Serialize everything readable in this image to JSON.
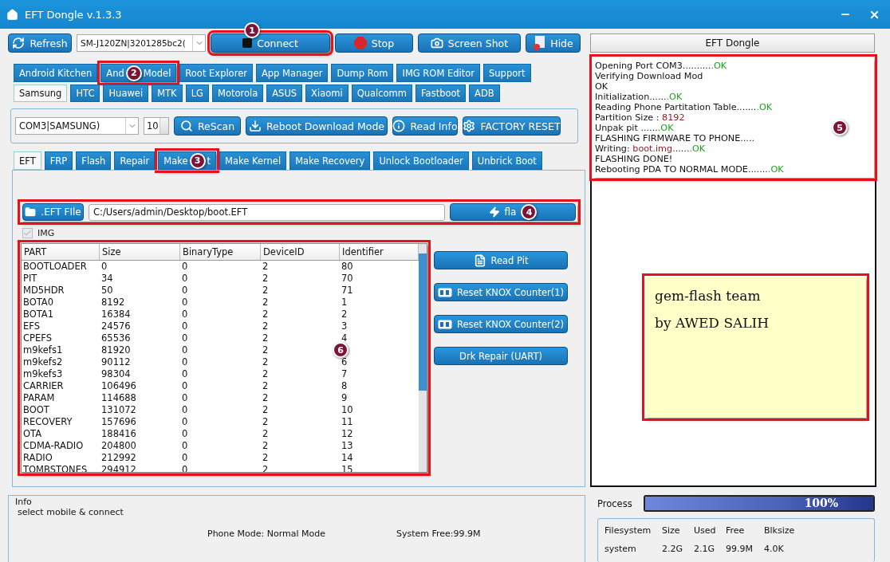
{
  "window": {
    "title": "EFT Dongle  v.1.3.3"
  },
  "toolbar": {
    "buttons": [
      {
        "kind": "refresh",
        "label": "Refresh"
      },
      {
        "kind": "device",
        "value": "SM-J120ZN|3201285bc2("
      },
      {
        "kind": "connect",
        "label": "Connect",
        "marker": "1",
        "highlight": true
      },
      {
        "kind": "stop",
        "label": "Stop"
      },
      {
        "kind": "camera",
        "label": "Screen Shot"
      },
      {
        "kind": "hide",
        "label": "Hide"
      }
    ]
  },
  "main_tabs": [
    {
      "label": "Android Kitchen",
      "selected": false
    },
    {
      "label": "And",
      "marker": "2",
      "label_after": "Model",
      "selected": false,
      "highlight": true
    },
    {
      "label": "Root Explorer",
      "selected": false
    },
    {
      "label": "App Manager",
      "selected": false
    },
    {
      "label": "Dump Rom",
      "selected": false
    },
    {
      "label": "IMG ROM Editor",
      "selected": false
    },
    {
      "label": "Support",
      "selected": false
    }
  ],
  "brand_tabs": [
    {
      "label": "Samsung",
      "selected": true
    },
    {
      "label": "HTC",
      "selected": false
    },
    {
      "label": "Huawei",
      "selected": false
    },
    {
      "label": "MTK",
      "selected": false
    },
    {
      "label": "LG",
      "selected": false
    },
    {
      "label": "Motorola",
      "selected": false
    },
    {
      "label": "ASUS",
      "selected": false
    },
    {
      "label": "Xiaomi",
      "selected": false
    },
    {
      "label": "Qualcomm",
      "selected": false
    },
    {
      "label": "Fastboot",
      "selected": false
    },
    {
      "label": "ADB",
      "selected": false
    }
  ],
  "port_bar": {
    "port": "COM3|SAMSUNG)",
    "count": "10",
    "buttons": [
      {
        "kind": "search",
        "label": "ReScan"
      },
      {
        "kind": "download",
        "label": "Reboot  Download Mode"
      },
      {
        "kind": "info",
        "label": "Read Info"
      },
      {
        "kind": "gear",
        "label": "FACTORY RESET"
      }
    ]
  },
  "sub_tabs": [
    {
      "label": "EFT",
      "selected": true
    },
    {
      "label": "FRP",
      "selected": false
    },
    {
      "label": "Flash",
      "selected": false
    },
    {
      "label": "Repair",
      "selected": false
    },
    {
      "label": "Make",
      "marker": "3",
      "label_after": "t",
      "selected": false,
      "highlight": true
    },
    {
      "label": "Make Kernel",
      "selected": false
    },
    {
      "label": "Make Recovery",
      "selected": false
    },
    {
      "label": "Unlock Bootloader",
      "selected": false
    },
    {
      "label": "Unbrick Boot",
      "selected": false
    }
  ],
  "file_row": {
    "highlight": true,
    "file_button": ".EFT FIle",
    "path": "C:/Users/admin/Desktop/boot.EFT",
    "flash_button": "fla",
    "marker": "4"
  },
  "img_checkbox": {
    "label": "IMG",
    "checked": true,
    "disabled": true
  },
  "table": {
    "highlight": true,
    "marker": "6",
    "columns": [
      "PART",
      "Size",
      "BinaryType",
      "DeviceID",
      "Identifier"
    ],
    "rows": [
      [
        "BOOTLOADER",
        "0",
        "0",
        "2",
        "80"
      ],
      [
        "PIT",
        "34",
        "0",
        "2",
        "70"
      ],
      [
        "MD5HDR",
        "50",
        "0",
        "2",
        "71"
      ],
      [
        "BOTA0",
        "8192",
        "0",
        "2",
        "1"
      ],
      [
        "BOTA1",
        "16384",
        "0",
        "2",
        "2"
      ],
      [
        "EFS",
        "24576",
        "0",
        "2",
        "3"
      ],
      [
        "CPEFS",
        "65536",
        "0",
        "2",
        "4"
      ],
      [
        "m9kefs1",
        "81920",
        "0",
        "2"
      ],
      [
        "m9kefs2",
        "90112",
        "0",
        "2",
        "6"
      ],
      [
        "m9kefs3",
        "98304",
        "0",
        "2",
        "7"
      ],
      [
        "CARRIER",
        "106496",
        "0",
        "2",
        "8"
      ],
      [
        "PARAM",
        "114688",
        "0",
        "2",
        "9"
      ],
      [
        "BOOT",
        "131072",
        "0",
        "2",
        "10"
      ],
      [
        "RECOVERY",
        "157696",
        "0",
        "2",
        "11"
      ],
      [
        "OTA",
        "188416",
        "0",
        "2",
        "12"
      ],
      [
        "CDMA-RADIO",
        "204800",
        "0",
        "2",
        "13"
      ],
      [
        "RADIO",
        "212992",
        "0",
        "2",
        "14"
      ],
      [
        "TOMBSTONES",
        "294912",
        "0",
        "2",
        "15"
      ]
    ]
  },
  "side_buttons": [
    {
      "kind": "document",
      "label": "Read Pit"
    },
    {
      "kind": "knox",
      "label": "Reset KNOX Counter(1)"
    },
    {
      "kind": "knox",
      "label": "Reset KNOX Counter(2)"
    },
    {
      "kind": "plain",
      "label": "Drk Repair (UART)"
    }
  ],
  "info": {
    "title": "Info",
    "message": "select mobile & connect",
    "phone_mode": "Phone Mode: Normal Mode",
    "system_free": "System Free:99.9M"
  },
  "right_panel": {
    "header": "EFT Dongle",
    "log_highlight": true,
    "marker": "5",
    "log": [
      [
        {
          "kind": "plain",
          "text": "Opening Port COM3.........."
        },
        {
          "kind": "ok",
          "text": ".OK"
        }
      ],
      [
        {
          "kind": "plain",
          "text": "Verifying Download Mod"
        }
      ],
      [
        {
          "kind": "plain",
          "text": "OK"
        }
      ],
      [
        {
          "kind": "plain",
          "text": "Initialization......"
        },
        {
          "kind": "ok",
          "text": ".OK"
        }
      ],
      [
        {
          "kind": "plain",
          "text": "Reading Phone Partitation Table......."
        },
        {
          "kind": "ok",
          "text": ".OK"
        }
      ],
      [
        {
          "kind": "plain",
          "text": "Partition Size : "
        },
        {
          "kind": "value",
          "text": "8192"
        }
      ],
      [
        {
          "kind": "plain",
          "text": "Unpak pit ......"
        },
        {
          "kind": "ok",
          "text": ".OK"
        }
      ],
      [
        {
          "kind": "plain",
          "text": "FLASHING FIRMWARE TO PHONE....."
        }
      ],
      [
        {
          "kind": "plain",
          "text": "Writing: "
        },
        {
          "kind": "value",
          "text": "boot.img"
        },
        {
          "kind": "plain",
          "text": "......"
        },
        {
          "kind": "ok",
          "text": ".OK"
        }
      ],
      [
        {
          "kind": "plain",
          "text": "FLASHING DONE!"
        }
      ],
      [
        {
          "kind": "plain",
          "text": "Rebooting PDA TO NORMAL MODE......."
        },
        {
          "kind": "ok",
          "text": ".OK"
        }
      ]
    ],
    "note": {
      "highlight": true,
      "lines": [
        "gem-flash team",
        "by AWED SALIH"
      ]
    },
    "process": {
      "label": "Process",
      "level": 1,
      "reading": "100%"
    },
    "filesystem": {
      "columns": [
        "Filesystem",
        "Size",
        "Used",
        "Free",
        "Blksize"
      ],
      "rows": [
        [
          "system",
          "2.2G",
          "2.1G",
          "99.9M",
          "4.0K"
        ]
      ]
    }
  }
}
